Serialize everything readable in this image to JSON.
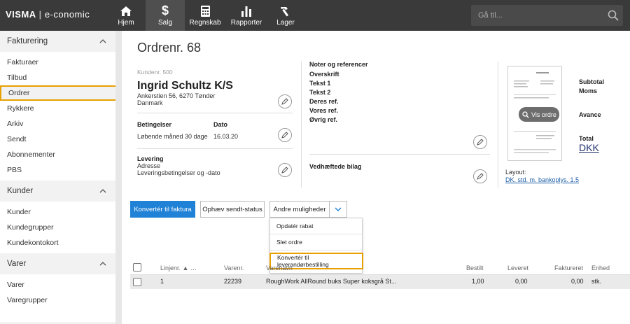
{
  "brand": {
    "name_bold": "VISMA",
    "name_light": "e-conomic"
  },
  "nav": [
    {
      "label": "Hjem",
      "icon": "home-icon"
    },
    {
      "label": "Salg",
      "icon": "dollar-icon",
      "active": true
    },
    {
      "label": "Regnskab",
      "icon": "calculator-icon"
    },
    {
      "label": "Rapporter",
      "icon": "bar-chart-icon"
    },
    {
      "label": "Lager",
      "icon": "hammer-icon"
    }
  ],
  "search": {
    "placeholder": "Gå til..."
  },
  "sidebar": {
    "fakturering": {
      "title": "Fakturering",
      "items": [
        "Fakturaer",
        "Tilbud",
        "Ordrer",
        "Rykkere",
        "Arkiv",
        "Sendt",
        "Abonnementer",
        "PBS"
      ],
      "selected": "Ordrer"
    },
    "kunder": {
      "title": "Kunder",
      "items": [
        "Kunder",
        "Kundegrupper",
        "Kundekontokort"
      ]
    },
    "varer": {
      "title": "Varer",
      "items": [
        "Varer",
        "Varegrupper"
      ]
    }
  },
  "order": {
    "title": "Ordrenr. 68",
    "kundenr": "Kundenr. 500",
    "customer_name": "Ingrid Schultz K/S",
    "address_line1": "Ankerstien 56, 6270 Tønder",
    "address_line2": "Danmark",
    "betingelser_label": "Betingelser",
    "betingelser_value": "Løbende måned 30 dage",
    "dato_label": "Dato",
    "dato_value": "16.03.20",
    "levering_label": "Levering",
    "levering_line1": "Adresse",
    "levering_line2": "Leveringsbetingelser og -dato"
  },
  "notes": {
    "title": "Noter og referencer",
    "fields": [
      "Overskrift",
      "Tekst 1",
      "Tekst 2",
      "Deres ref.",
      "Vores ref.",
      "Øvrig ref."
    ],
    "attachments": "Vedhæftede bilag"
  },
  "preview": {
    "button": "Vis ordre",
    "layout_label": "Layout:",
    "layout_value": "DK. std. m. bankoplys. 1.5"
  },
  "totals": {
    "subtotal": "Subtotal",
    "moms": "Moms",
    "avance": "Avance",
    "total": "Total",
    "currency": "DKK"
  },
  "actions": {
    "convert_invoice": "Konvertér til faktura",
    "cancel_sent": "Ophæv sendt-status",
    "more": "Andre muligheder",
    "dropdown": [
      "Opdatér rabat",
      "Slet ordre",
      "Konvertér til leverandørbestilling"
    ]
  },
  "table": {
    "headers": [
      "Linjenr.",
      "Varenr.",
      "Varenavn",
      "Bestilt",
      "Leveret",
      "Faktureret",
      "Enhed"
    ],
    "rows": [
      {
        "linjenr": "1",
        "varenr": "22239",
        "varenavn": "RoughWork AllRound buks Super koksgrå St...",
        "bestilt": "1,00",
        "leveret": "0,00",
        "faktureret": "0,00",
        "enhed": "stk."
      }
    ]
  }
}
